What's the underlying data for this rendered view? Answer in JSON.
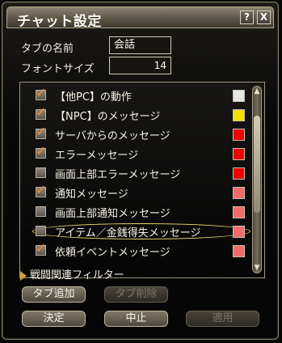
{
  "window": {
    "title": "チャット設定",
    "help_label": "?",
    "close_label": "X"
  },
  "settings": {
    "tab_name_label": "タブの名前",
    "tab_name_value": "会話",
    "font_size_label": "フォントサイズ",
    "font_size_value": "14"
  },
  "list": {
    "items": [
      {
        "label": "【他PC】の動作",
        "checked": true,
        "color": "#e6e6e6"
      },
      {
        "label": "【NPC】のメッセージ",
        "checked": true,
        "color": "#f5e000"
      },
      {
        "label": "サーバからのメッセージ",
        "checked": true,
        "color": "#f00000"
      },
      {
        "label": "エラーメッセージ",
        "checked": true,
        "color": "#f00000"
      },
      {
        "label": "画面上部エラーメッセージ",
        "checked": false,
        "color": "#f00000"
      },
      {
        "label": "通知メッセージ",
        "checked": true,
        "color": "#f06b6b"
      },
      {
        "label": "画面上部通知メッセージ",
        "checked": false,
        "color": "#f06b6b"
      },
      {
        "label": "アイテム／金銭得失メッセージ",
        "checked": false,
        "color": "#f06b6b"
      },
      {
        "label": "依頼イベントメッセージ",
        "checked": true,
        "color": "#f06b6b"
      }
    ],
    "filter_label": "戦闘関連フィルター",
    "scroll_up": "▲",
    "scroll_down": "▼"
  },
  "buttons": {
    "add_tab": "タブ追加",
    "delete_tab": "タブ削除",
    "ok": "決定",
    "cancel": "中止",
    "apply": "適用"
  }
}
